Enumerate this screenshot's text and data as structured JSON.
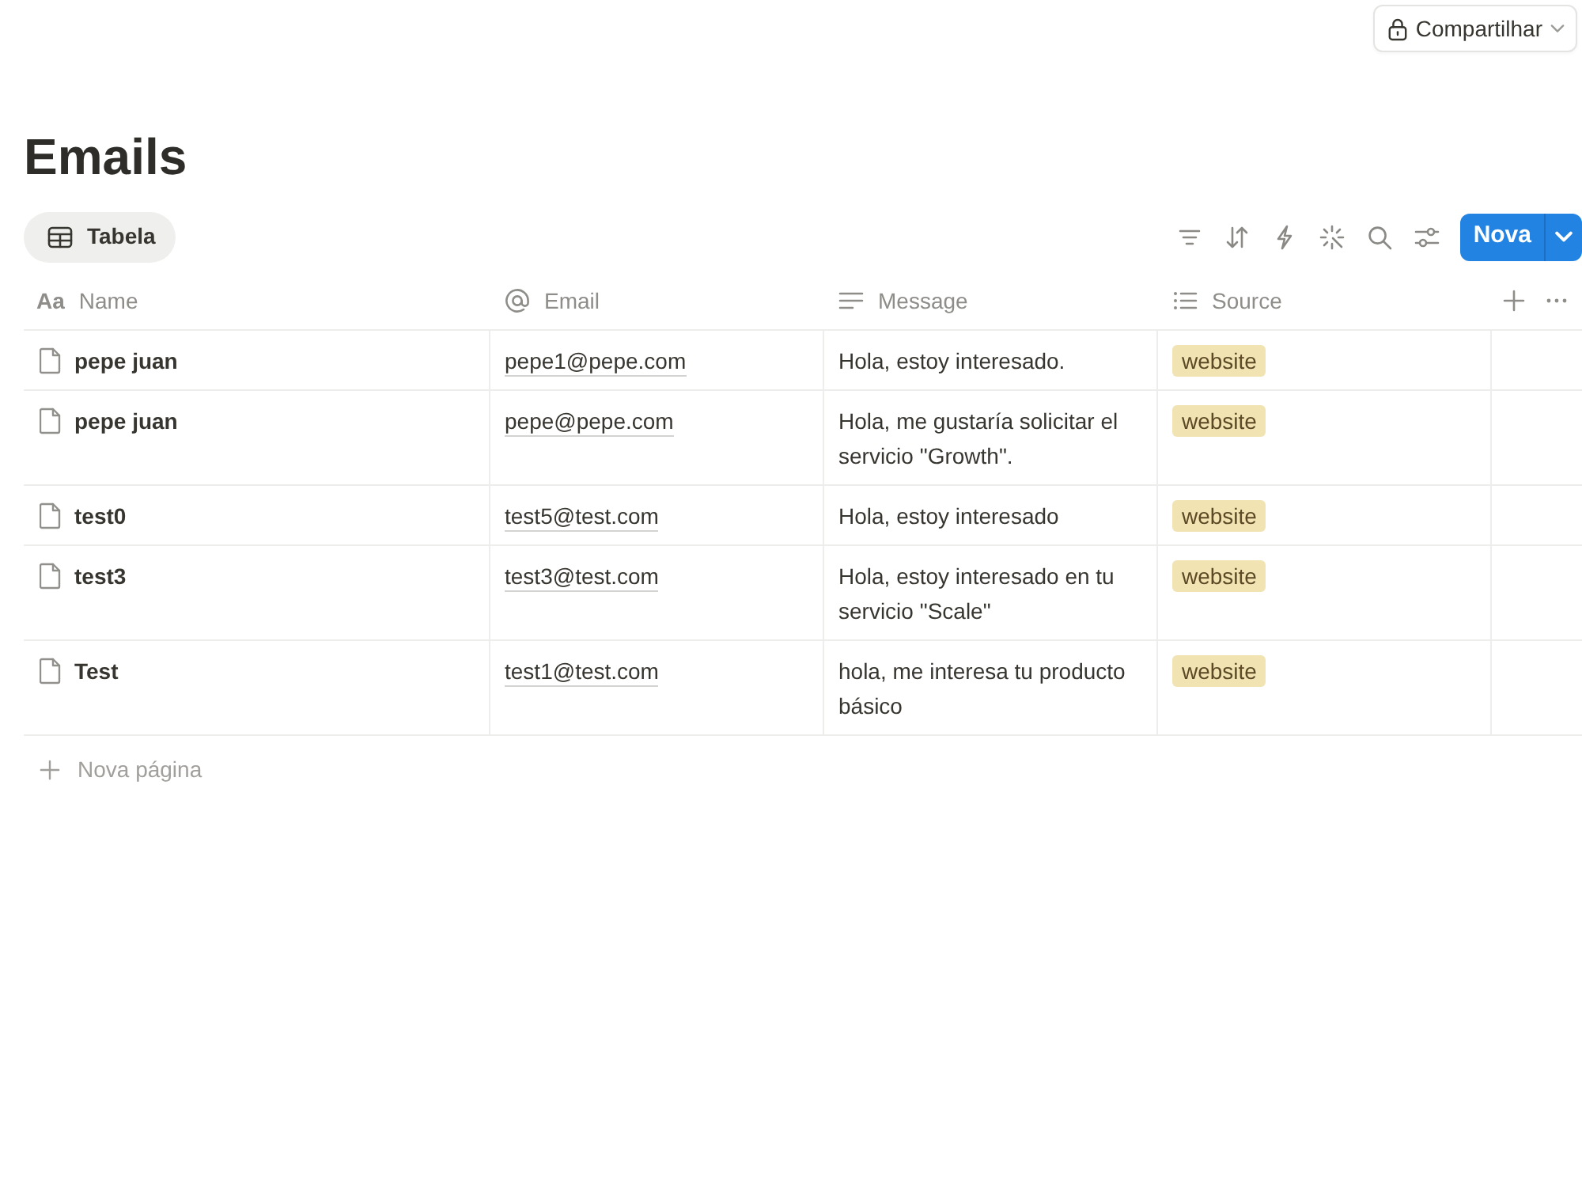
{
  "share_button": {
    "label": "Compartilhar"
  },
  "page": {
    "title": "Emails"
  },
  "views": [
    {
      "label": "Tabela",
      "selected": true
    }
  ],
  "new_button": {
    "label": "Nova"
  },
  "table": {
    "columns": [
      {
        "label": "Name",
        "kind": "title",
        "icon": "Aa"
      },
      {
        "label": "Email",
        "kind": "email"
      },
      {
        "label": "Message",
        "kind": "text"
      },
      {
        "label": "Source",
        "kind": "multi_select"
      }
    ],
    "rows": [
      [
        "pepe juan",
        "pepe1@pepe.com",
        "Hola, estoy interesado.",
        [
          "website"
        ]
      ],
      [
        "pepe juan",
        "pepe@pepe.com",
        "Hola, me gustaría solicitar el servicio \"Growth\".",
        [
          "website"
        ]
      ],
      [
        "test0",
        "test5@test.com",
        "Hola, estoy interesado",
        [
          "website"
        ]
      ],
      [
        "test3",
        "test3@test.com",
        "Hola, estoy interesado en tu servicio \"Scale\"",
        [
          "website"
        ]
      ],
      [
        "Test",
        "test1@test.com",
        "hola, me interesa tu producto básico",
        [
          "website"
        ]
      ]
    ],
    "add_row": {
      "label": "Nova página"
    }
  }
}
